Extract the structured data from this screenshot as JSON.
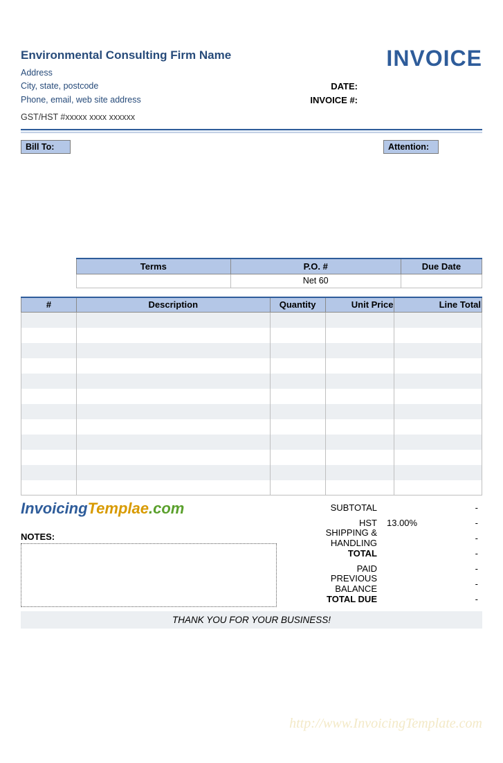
{
  "header": {
    "firm_name": "Environmental Consulting Firm Name",
    "address": "Address",
    "city_line": "City, state, postcode",
    "contact_line": "Phone, email, web site address",
    "gst_line": "GST/HST #xxxxx xxxx xxxxxx",
    "invoice_title": "INVOICE",
    "date_label": "DATE:",
    "invoice_no_label": "INVOICE #:"
  },
  "labels": {
    "bill_to": "Bill To:",
    "attention": "Attention:",
    "notes": "NOTES:"
  },
  "terms": {
    "headers": {
      "terms": "Terms",
      "po": "P.O. #",
      "due": "Due Date"
    },
    "values": {
      "terms": "",
      "po": "Net 60",
      "due": ""
    }
  },
  "items": {
    "headers": {
      "num": "#",
      "desc": "Description",
      "qty": "Quantity",
      "price": "Unit Price",
      "total": "Line Total"
    }
  },
  "totals": {
    "subtotal_label": "SUBTOTAL",
    "subtotal_value": "-",
    "hst_label": "HST",
    "hst_rate": "13.00%",
    "hst_value": "-",
    "shipping_label": "SHIPPING & HANDLING",
    "shipping_value": "-",
    "total_label": "TOTAL",
    "total_value": "-",
    "paid_label": "PAID",
    "paid_value": "-",
    "prev_label": "PREVIOUS BALANCE",
    "prev_value": "-",
    "due_label": "TOTAL DUE",
    "due_value": "-"
  },
  "footer": {
    "thanks": "THANK YOU FOR YOUR BUSINESS!",
    "logo_p1": "Invoicing",
    "logo_p2": "Templae",
    "logo_p3": ".com",
    "watermark": "http://www.InvoicingTemplate.com"
  }
}
